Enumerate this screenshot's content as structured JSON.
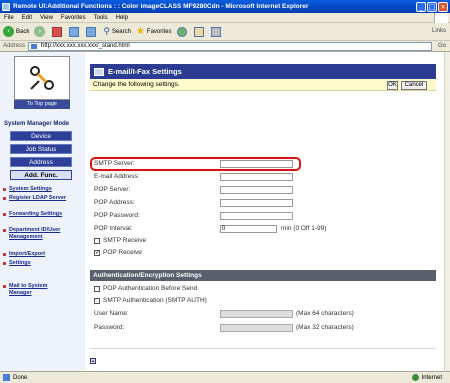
{
  "window": {
    "title": "Remote UI:Additional Functions : : Color imageCLASS MF9280Cdn - Microsoft Internet Explorer",
    "minimize": "_",
    "maximize": "□",
    "close": "×"
  },
  "menubar": {
    "items": [
      "File",
      "Edit",
      "View",
      "Favorites",
      "Tools",
      "Help"
    ]
  },
  "toolbar": {
    "back": "Back",
    "back_arrow": "‹",
    "forward_arrow": "›",
    "search": "Search",
    "favorites": "Favorites",
    "links": "Links"
  },
  "address": {
    "label": "Address",
    "url": "http://xxx.xxx.xxx.xxx/_stand.html",
    "go": "Go"
  },
  "leftnav": {
    "top_page": "To Top page",
    "mode_label": "System Manager Mode",
    "modes": [
      "Device",
      "Job Status",
      "Address",
      "Add. Func."
    ],
    "links": [
      "System Settings",
      "Register LDAP Server",
      "Forwarding Settings",
      "Department ID/User Management",
      "Import/Export",
      "Settings"
    ],
    "mail": "Mail to System Manager"
  },
  "content": {
    "header": "E-mail/I-Fax Settings",
    "instructions": "Change the following settings.",
    "ok": "OK",
    "cancel": "Cancel",
    "fields": [
      "SMTP Server:",
      "E-mail Address:",
      "POP Server:",
      "POP Address:",
      "POP Password:",
      "POP Interval:"
    ],
    "pop_interval_value": "0",
    "pop_interval_suffix": "min (0:Off 1-99)",
    "smtp_receive": "SMTP Receive",
    "pop_receive": "POP Receive",
    "auth_section": "Authentication/Encryption Settings",
    "pop_before_send": "POP Authentication Before Send",
    "smtp_auth": "SMTP Authentication (SMTP AUTH)",
    "user_name": "User Name:",
    "user_name_note": "(Max 64 characters)",
    "password": "Password:",
    "password_note": "(Max 32 characters)"
  },
  "statusbar": {
    "status": "Done",
    "zone": "Internet"
  }
}
